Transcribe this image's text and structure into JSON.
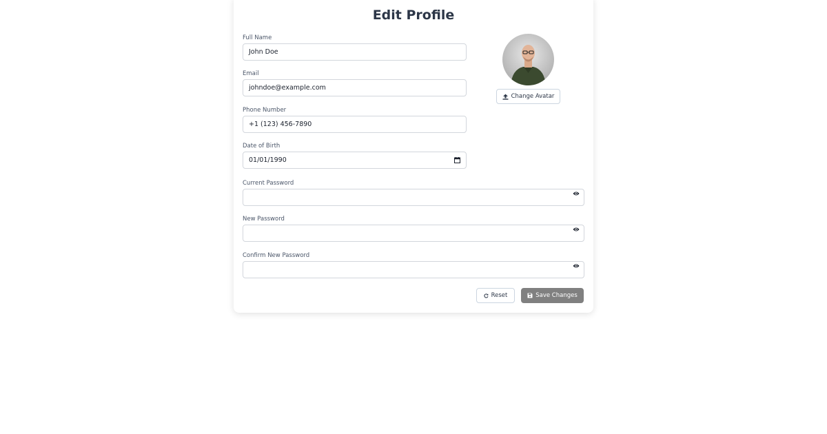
{
  "page": {
    "title": "Edit Profile"
  },
  "fields": {
    "full_name": {
      "label": "Full Name",
      "value": "John Doe"
    },
    "email": {
      "label": "Email",
      "value": "johndoe@example.com"
    },
    "phone": {
      "label": "Phone Number",
      "value": "+1 (123) 456-7890"
    },
    "dob": {
      "label": "Date of Birth",
      "value": "01/01/1990",
      "icon": "calendar-icon"
    },
    "current_password": {
      "label": "Current Password",
      "value": "",
      "icon": "eye-icon"
    },
    "new_password": {
      "label": "New Password",
      "value": "",
      "icon": "eye-icon"
    },
    "confirm_password": {
      "label": "Confirm New Password",
      "value": "",
      "icon": "eye-icon"
    }
  },
  "avatar": {
    "button_label": "Change Avatar",
    "button_icon": "upload-icon"
  },
  "actions": {
    "reset_label": "Reset",
    "reset_icon": "reset-icon",
    "save_label": "Save Changes",
    "save_icon": "save-icon"
  },
  "colors": {
    "save_button": "#808080",
    "title_text": "#2d3748",
    "input_border": "#d2d6dc"
  }
}
